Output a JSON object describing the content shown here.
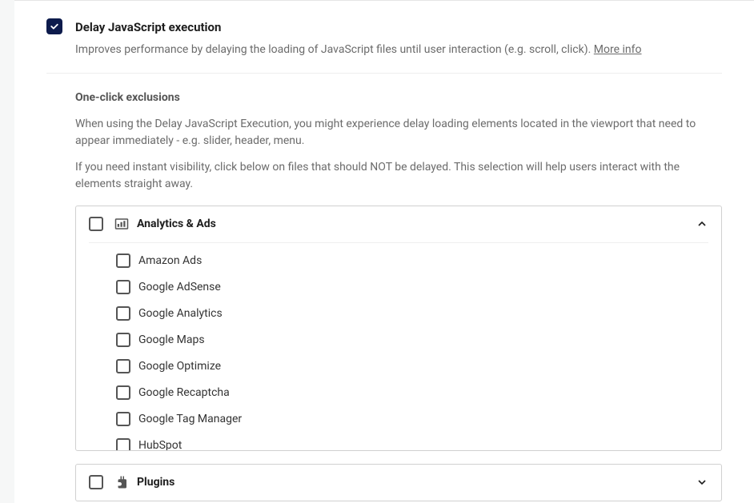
{
  "setting": {
    "title": "Delay JavaScript execution",
    "description": "Improves performance by delaying the loading of JavaScript files until user interaction (e.g. scroll, click).",
    "more_info": "More info",
    "checked": true
  },
  "exclusions": {
    "heading": "One-click exclusions",
    "para1": "When using the Delay JavaScript Execution, you might experience delay loading elements located in the viewport that need to appear immediately - e.g. slider, header, menu.",
    "para2": "If you need instant visibility, click below on files that should NOT be delayed. This selection will help users interact with the elements straight away."
  },
  "groups": {
    "analytics": {
      "title": "Analytics & Ads",
      "items": [
        "Amazon Ads",
        "Google AdSense",
        "Google Analytics",
        "Google Maps",
        "Google Optimize",
        "Google Recaptcha",
        "Google Tag Manager",
        "HubSpot"
      ]
    },
    "plugins": {
      "title": "Plugins"
    }
  }
}
